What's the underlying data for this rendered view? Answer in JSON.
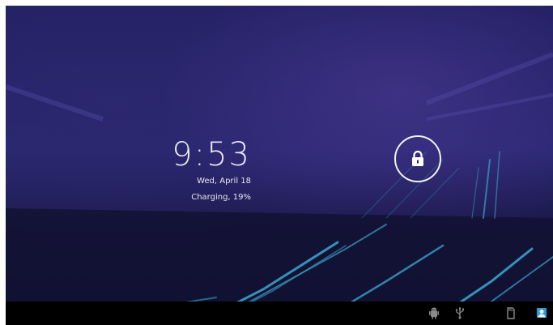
{
  "lockscreen": {
    "time": "9:53",
    "date": "Wed, April 18",
    "status": "Charging, 19%"
  },
  "unlock": {
    "icon": "padlock-icon"
  },
  "status_bar": {
    "icons": [
      "android-debug-icon",
      "usb-icon",
      "sd-card-icon",
      "user-avatar-icon"
    ]
  },
  "colors": {
    "background": "#25236a",
    "accent_streak": "#3aa0c8",
    "text": "#e8e8f2",
    "navbar": "#000000"
  }
}
